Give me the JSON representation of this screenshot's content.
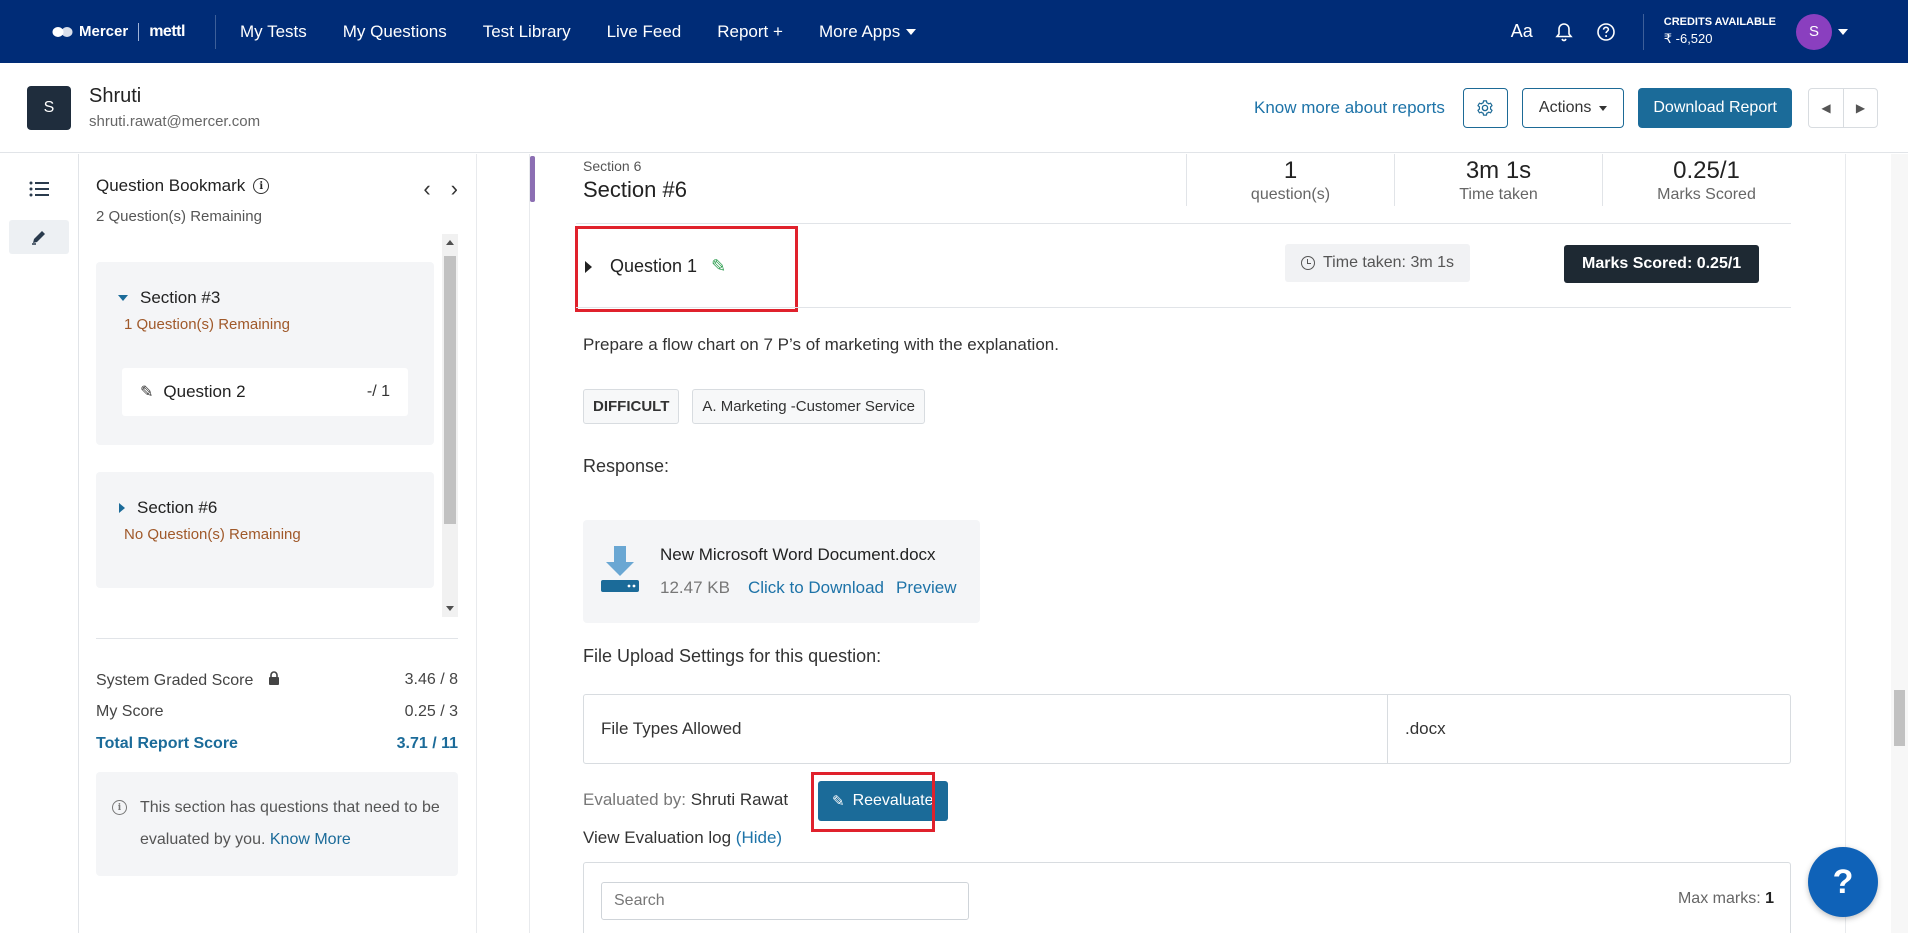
{
  "topnav": {
    "brand": "Mercer",
    "brand_product": "mettl",
    "links": [
      "My Tests",
      "My Questions",
      "Test Library",
      "Live Feed",
      "Report +",
      "More Apps"
    ],
    "credits_label": "CREDITS AVAILABLE",
    "credits_value": "₹ -6,520",
    "user_initial": "S",
    "font_icon": "Aa",
    "bell_icon": "bell-icon",
    "help_icon": "question-circle-icon",
    "colors": {
      "bar": "#002c77",
      "avatar": "#8a3fbf"
    }
  },
  "candidate": {
    "initial": "S",
    "name": "Shruti",
    "email": "shruti.rawat@mercer.com",
    "know_more": "Know more about reports",
    "actions_label": "Actions",
    "download_label": "Download Report"
  },
  "bookmark": {
    "title": "Question Bookmark",
    "remaining": "2 Question(s) Remaining",
    "sections": [
      {
        "name": "Section #3",
        "remaining": "1 Question(s) Remaining",
        "expanded": true,
        "questions": [
          {
            "label": "Question 2",
            "score": "-/ 1"
          }
        ]
      },
      {
        "name": "Section #6",
        "remaining": "No Question(s) Remaining",
        "expanded": false
      }
    ],
    "scores": [
      {
        "label": "System Graded Score",
        "value": "3.46 / 8"
      },
      {
        "label": "My Score",
        "value": "0.25 / 3"
      },
      {
        "label": "Total Report Score",
        "value": "3.71 / 11"
      }
    ],
    "notice_text": "This section has questions that need to be evaluated by you.",
    "notice_link": "Know More"
  },
  "section": {
    "label": "Section 6",
    "name": "Section #6",
    "stats": [
      {
        "value": "1",
        "label": "question(s)"
      },
      {
        "value": "3m 1s",
        "label": "Time taken"
      },
      {
        "value": "0.25/1",
        "label": "Marks Scored"
      }
    ]
  },
  "question": {
    "title": "Question 1",
    "time_taken": "Time taken: 3m 1s",
    "marks_scored": "Marks Scored: 0.25/1",
    "text": "Prepare a flow chart on 7 P’s of marketing with the explanation.",
    "tags": [
      "DIFFICULT",
      "A. Marketing -Customer Service"
    ],
    "response_label": "Response:",
    "file": {
      "name": "New Microsoft Word Document.docx",
      "size": "12.47 KB",
      "download_link": "Click to Download",
      "preview_link": "Preview"
    },
    "upload_settings_title": "File Upload Settings for this question:",
    "upload_settings": [
      {
        "key": "File Types Allowed",
        "value": ".docx"
      }
    ],
    "evaluated_by_label": "Evaluated by:",
    "evaluated_by_name": "Shruti Rawat",
    "reevaluate_label": "Reevaluate",
    "eval_log_label": "View Evaluation log",
    "eval_log_hide": "(Hide)",
    "search_placeholder": "Search",
    "max_marks_label": "Max marks:",
    "max_marks_value": "1"
  },
  "help_fab": "?"
}
